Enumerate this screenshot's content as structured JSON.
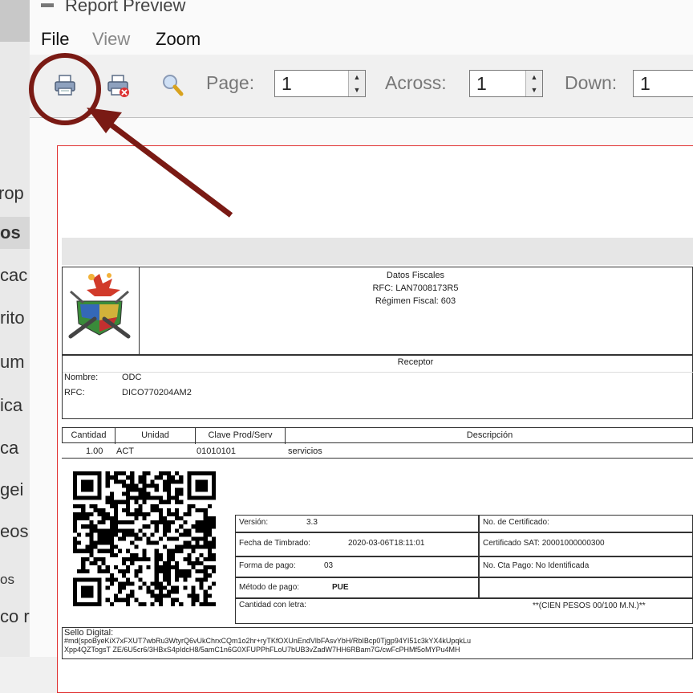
{
  "window": {
    "title": "Report Preview"
  },
  "menu": {
    "file": "File",
    "view": "View",
    "zoom": "Zoom"
  },
  "toolbar": {
    "page_label": "Page:",
    "page_value": "1",
    "across_label": "Across:",
    "across_value": "1",
    "down_label": "Down:",
    "down_value": "1"
  },
  "sidebar": {
    "items": [
      "rop",
      "os",
      "cac",
      "rito",
      "um",
      "ica",
      "ca",
      "gei",
      "eos",
      "os",
      "co r"
    ]
  },
  "report": {
    "emisor_banner": "",
    "datos_fiscales": "Datos Fiscales",
    "rfc_emisor": "RFC: LAN7008173R5",
    "regimen": "Régimen Fiscal: 603",
    "receptor_title": "Receptor",
    "nombre_label": "Nombre:",
    "nombre_value": "ODC",
    "rfc_label": "RFC:",
    "rfc_value": "DICO770204AM2",
    "col_cantidad": "Cantidad",
    "col_unidad": "Unidad",
    "col_clave": "Clave Prod/Serv",
    "col_descripcion": "Descripción",
    "row_cantidad": "1.00",
    "row_unidad": "ACT",
    "row_clave": "01010101",
    "row_descripcion": "servicios",
    "version_label": "Versión:",
    "version_value": "3.3",
    "fecha_label": "Fecha de Timbrado:",
    "fecha_value": "2020-03-06T18:11:01",
    "forma_label": "Forma de pago:",
    "forma_value": "03",
    "metodo_label": "Método de pago:",
    "metodo_value": "PUE",
    "cantidad_letra_label": "Cantidad con letra:",
    "cantidad_letra_value": "**(CIEN PESOS 00/100 M.N.)**",
    "nocert_label": "No. de Certificado:",
    "certsat": "Certificado SAT: 20001000000300",
    "noctapago": "No. Cta Pago:  No Identificada",
    "sello_label": "Sello Digital:",
    "sello_line1": "#md(spoByeKiX7xFXUT7wbRu3WtyrQ6vUkChrxCQm1o2hr+ryTKfOXUnEndVlbFAsvYbH/RbIBcp0Tjgp94YI51c3kYX4kUpqkLu",
    "sello_line2": "Xpp4QZTogsT ZE/6U5cr6/3HBxS4pIdcH8/5amC1n6G0XFUPPhFLoU7bUB3vZadW7HH6RBam7G/cwFcPHMf5oMYPu4MH"
  },
  "colors": {
    "annotation": "#7a1a14",
    "page_border": "#e03030"
  }
}
